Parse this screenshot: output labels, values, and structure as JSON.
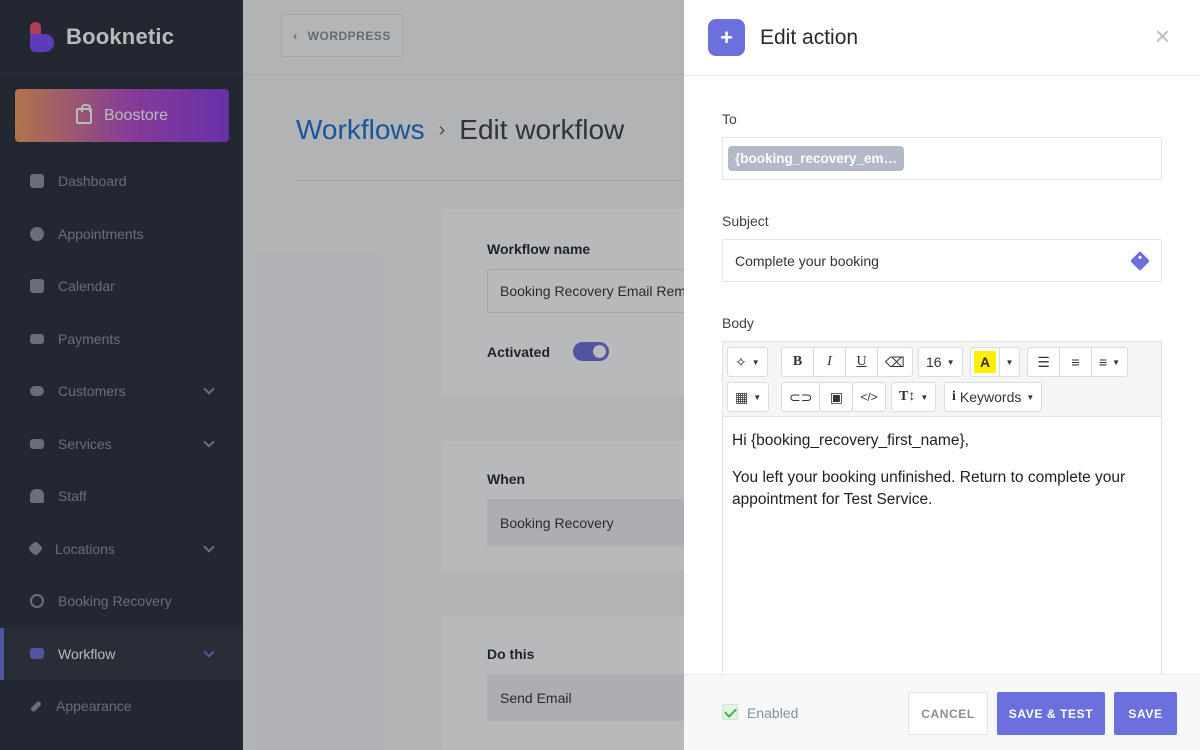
{
  "sidebar": {
    "brand": "Booknetic",
    "boostore": "Boostore",
    "items": [
      {
        "label": "Dashboard",
        "icon": "dashboard-icon",
        "chevron": false
      },
      {
        "label": "Appointments",
        "icon": "clock-icon",
        "chevron": false
      },
      {
        "label": "Calendar",
        "icon": "calendar-icon",
        "chevron": false
      },
      {
        "label": "Payments",
        "icon": "credit-card-icon",
        "chevron": false
      },
      {
        "label": "Customers",
        "icon": "users-icon",
        "chevron": true
      },
      {
        "label": "Services",
        "icon": "list-icon",
        "chevron": true
      },
      {
        "label": "Staff",
        "icon": "user-icon",
        "chevron": false
      },
      {
        "label": "Locations",
        "icon": "location-arrow-icon",
        "chevron": true
      },
      {
        "label": "Booking Recovery",
        "icon": "undo-icon",
        "chevron": false
      },
      {
        "label": "Workflow",
        "icon": "workflow-icon",
        "chevron": true,
        "active": true
      },
      {
        "label": "Appearance",
        "icon": "brush-icon",
        "chevron": false
      }
    ]
  },
  "main": {
    "wordpress_button": "WORDPRESS",
    "breadcrumb": {
      "link": "Workflows",
      "separator": "›",
      "current": "Edit workflow"
    },
    "workflow_name_label": "Workflow name",
    "workflow_name_value": "Booking Recovery Email Rem",
    "activated_label": "Activated",
    "when_label": "When",
    "when_value": "Booking Recovery",
    "do_this_label": "Do this",
    "do_this_value": "Send Email"
  },
  "drawer": {
    "title": "Edit action",
    "to_label": "To",
    "to_chip": "{booking_recovery_em…",
    "subject_label": "Subject",
    "subject_value": "Complete your booking",
    "body_label": "Body",
    "toolbar": {
      "font_size": "16",
      "keywords": "Keywords"
    },
    "body_lines": [
      "Hi {booking_recovery_first_name},",
      "You left your booking unfinished. Return to complete your appointment for Test Service."
    ],
    "enabled_label": "Enabled",
    "cancel": "CANCEL",
    "save_test": "SAVE & TEST",
    "save": "SAVE"
  },
  "colors": {
    "accent": "#6c70dc",
    "sidebar_bg": "#2a2f3b",
    "link": "#1e6fd9"
  }
}
